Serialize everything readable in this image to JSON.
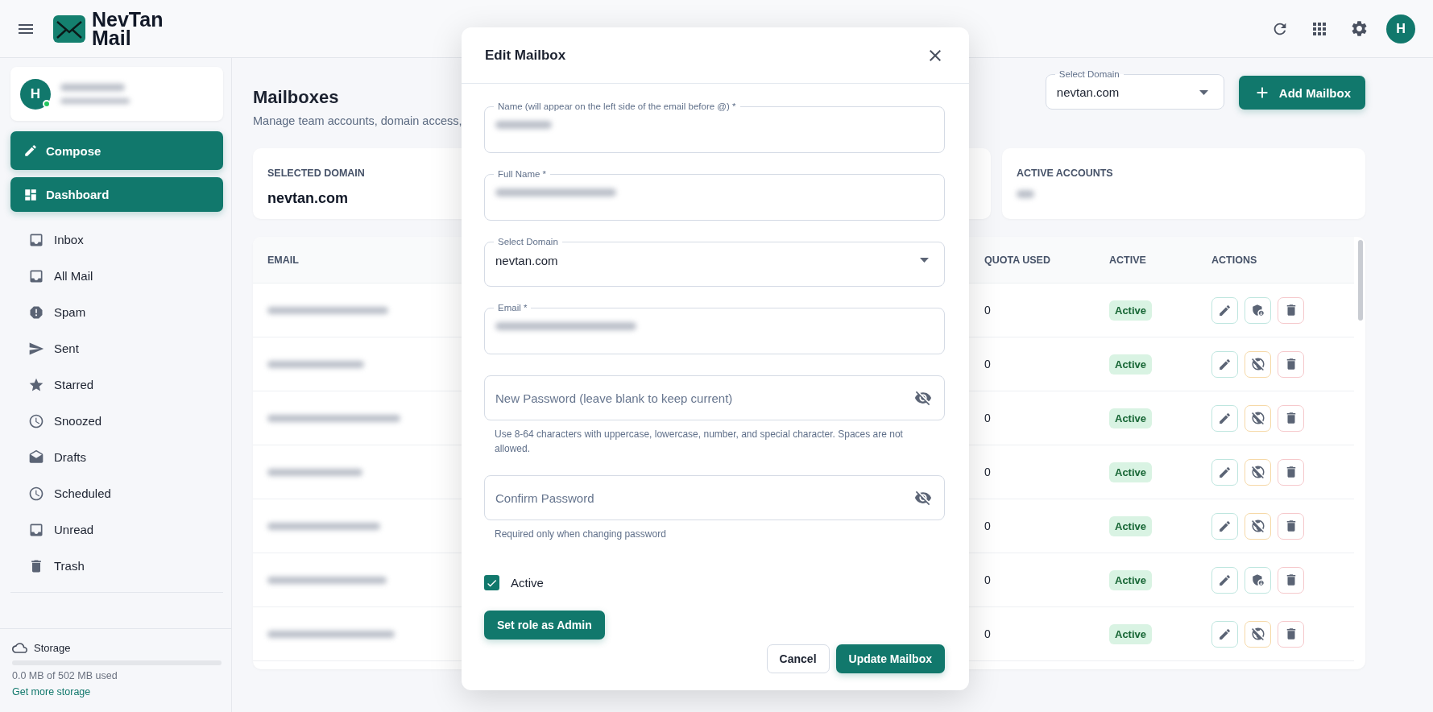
{
  "header": {
    "brand": "NevTan Mail",
    "avatar": "H"
  },
  "sidebar": {
    "user": {
      "initial": "H",
      "online": true,
      "name_redacted": true
    },
    "compose": "Compose",
    "dashboard": "Dashboard",
    "nav": [
      {
        "label": "Inbox",
        "kind": "inbox"
      },
      {
        "label": "All Mail",
        "kind": "inbox"
      },
      {
        "label": "Spam",
        "kind": "spam"
      },
      {
        "label": "Sent",
        "kind": "send"
      },
      {
        "label": "Starred",
        "kind": "star"
      },
      {
        "label": "Snoozed",
        "kind": "clock"
      },
      {
        "label": "Drafts",
        "kind": "drafts"
      },
      {
        "label": "Scheduled",
        "kind": "clock"
      },
      {
        "label": "Unread",
        "kind": "inbox"
      },
      {
        "label": "Trash",
        "kind": "trash"
      }
    ],
    "storage": {
      "title": "Storage",
      "level": 0,
      "usage": "0.0 MB of 502 MB used",
      "link": "Get more storage"
    }
  },
  "page": {
    "title": "Mailboxes",
    "subtitle": "Manage team accounts, domain access,",
    "domain_select": {
      "label": "Select Domain",
      "value": "nevtan.com"
    },
    "add_button": "Add Mailbox"
  },
  "stats": [
    {
      "label": "SELECTED DOMAIN",
      "value": "nevtan.com"
    },
    {
      "label": "ACTIVE ACCOUNTS",
      "value_redacted": true
    }
  ],
  "table": {
    "columns": [
      "EMAIL",
      "QUOTA USED",
      "ACTIVE",
      "ACTIONS"
    ],
    "rows": [
      {
        "quota": "0",
        "status": "Active",
        "kind": "admin"
      },
      {
        "quota": "0",
        "status": "Active",
        "kind": "revoke"
      },
      {
        "quota": "0",
        "status": "Active",
        "kind": "revoke"
      },
      {
        "quota": "0",
        "status": "Active",
        "kind": "revoke"
      },
      {
        "quota": "0",
        "status": "Active",
        "kind": "revoke"
      },
      {
        "quota": "0",
        "status": "Active",
        "kind": "admin"
      },
      {
        "quota": "0",
        "status": "Active",
        "kind": "revoke"
      }
    ]
  },
  "modal": {
    "title": "Edit Mailbox",
    "fields": [
      {
        "kind": "text",
        "label": "Name (will appear on the left side of the email before @) *",
        "redacted": true
      },
      {
        "kind": "text",
        "label": "Full Name *",
        "redacted": true
      },
      {
        "kind": "select",
        "label": "Select Domain",
        "value": "nevtan.com"
      },
      {
        "kind": "text",
        "label": "Email *",
        "redacted": true
      },
      {
        "kind": "password",
        "placeholder": "New Password (leave blank to keep current)",
        "helper": "Use 8-64 characters with uppercase, lowercase, number, and special character. Spaces are not allowed."
      },
      {
        "kind": "password",
        "placeholder": "Confirm Password",
        "helper": "Required only when changing password"
      }
    ],
    "active": {
      "label": "Active",
      "checked": true
    },
    "admin_button": "Set role as Admin",
    "cancel": "Cancel",
    "submit": "Update Mailbox"
  }
}
